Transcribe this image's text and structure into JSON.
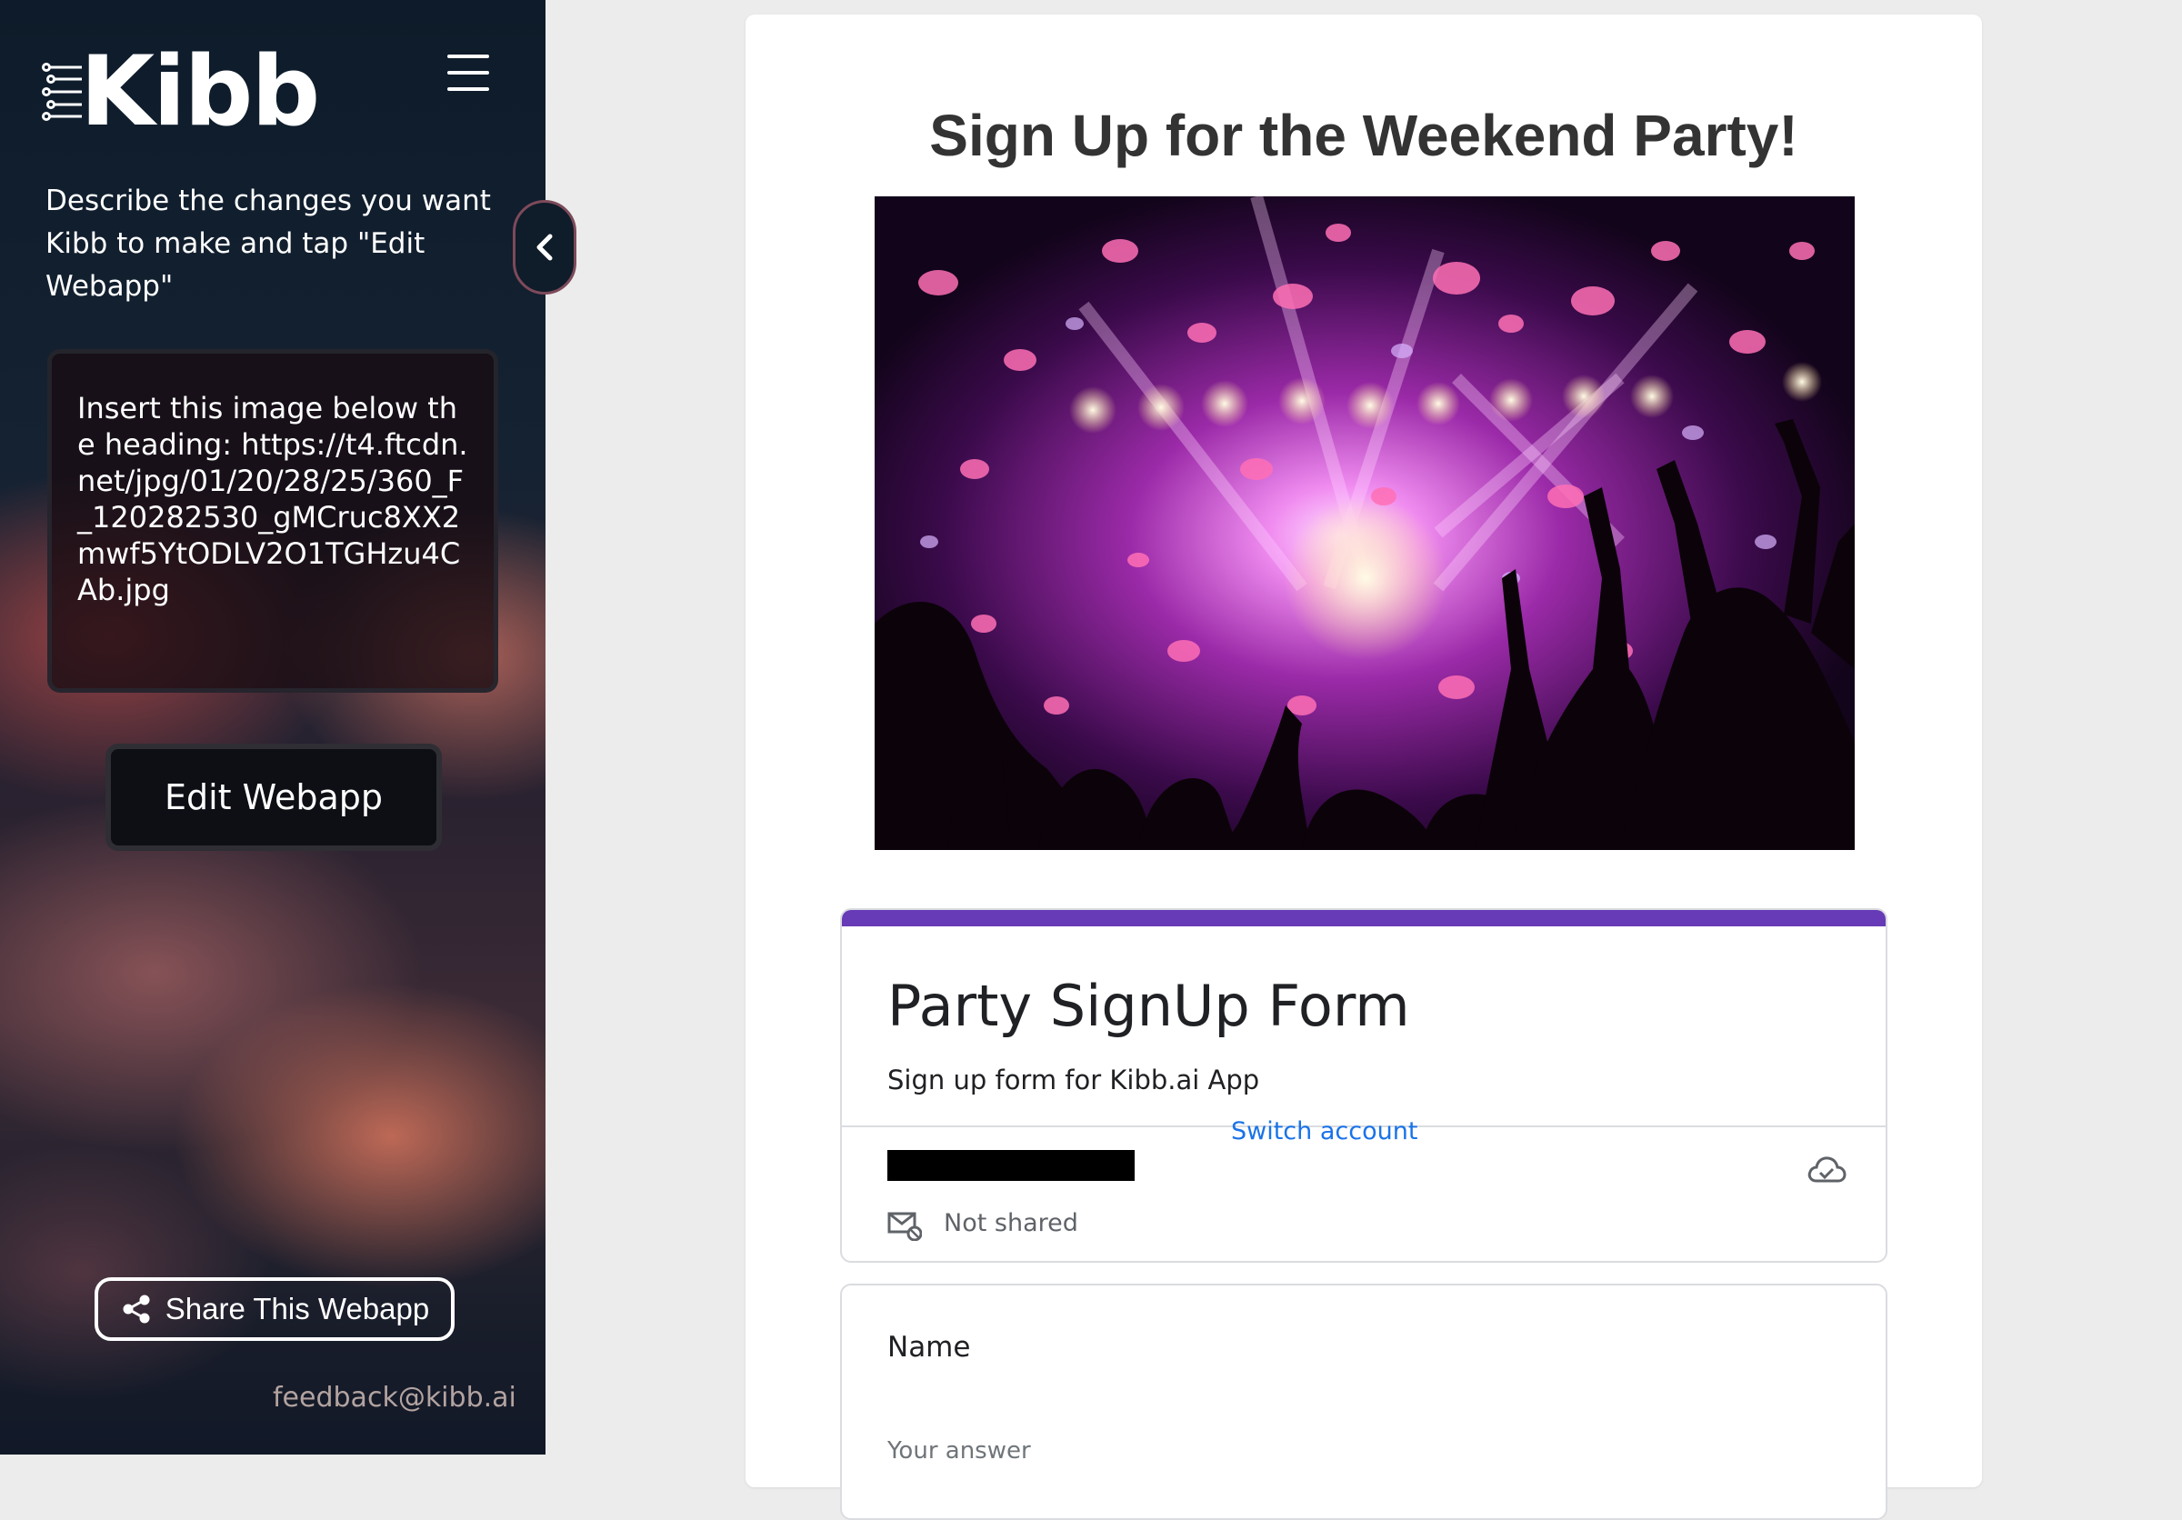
{
  "sidebar": {
    "app_name": "Kibb",
    "description": "Describe the changes you want Kibb to make and tap \"Edit Webapp\"",
    "prompt_value": "Insert this image below the heading: https://t4.ftcdn.net/jpg/01/20/28/25/360_F_120282530_gMCruc8XX2mwf5YtODLV2O1TGHzu4CAb.jpg",
    "edit_button_label": "Edit Webapp",
    "share_button_label": "Share This Webapp",
    "feedback_email": "feedback@kibb.ai"
  },
  "main": {
    "page_title": "Sign Up for the Weekend Party!",
    "form": {
      "title": "Party SignUp Form",
      "description": "Sign up form for Kibb.ai App",
      "switch_account_label": "Switch account",
      "not_shared_label": "Not shared",
      "accent_color": "#673ab7",
      "questions": [
        {
          "label": "Name",
          "placeholder": "Your answer"
        }
      ]
    }
  },
  "icons": [
    "circuit-logo-icon",
    "hamburger-menu-icon",
    "chevron-left-icon",
    "share-icon",
    "cloud-check-icon",
    "mail-icon"
  ],
  "colors": {
    "link": "#1a73e8",
    "sidebar_dark": "#0f1c29"
  }
}
